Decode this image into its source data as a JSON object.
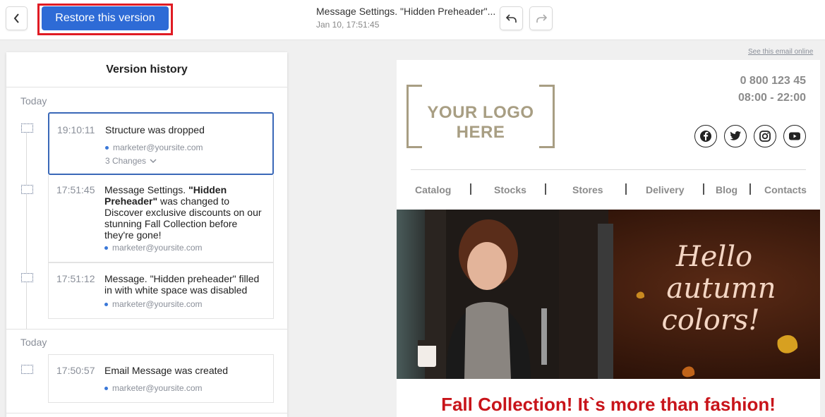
{
  "toolbar": {
    "restore_label": "Restore this version",
    "doc_title": "Message Settings. \"Hidden Preheader\"...",
    "doc_date": "Jan 10, 17:51:45"
  },
  "panel": {
    "title": "Version history",
    "groups": [
      {
        "label": "Today",
        "entries": [
          {
            "time": "19:10:11",
            "text": "Structure was dropped",
            "user": "marketer@yoursite.com",
            "changes": "3 Changes"
          },
          {
            "time": "17:51:45",
            "text_before": "Message Settings. ",
            "text_bold": "\"Hidden Preheader\"",
            "text_after": " was changed to Discover exclusive discounts on our stunning Fall Collection before they're gone!",
            "user": "marketer@yoursite.com"
          },
          {
            "time": "17:51:12",
            "text": "Message. \"Hidden preheader\" filled in with white space was disabled",
            "user": "marketer@yoursite.com"
          }
        ]
      },
      {
        "label": "Today",
        "entries": [
          {
            "time": "17:50:57",
            "text": "Email Message was created",
            "user": "marketer@yoursite.com"
          }
        ]
      }
    ]
  },
  "preview": {
    "see_online": "See this email online",
    "logo_text": "YOUR LOGO HERE",
    "phone": "0 800 123 45",
    "hours": "08:00 - 22:00",
    "social_icons": [
      "facebook-icon",
      "twitter-icon",
      "instagram-icon",
      "youtube-icon"
    ],
    "nav": [
      "Catalog",
      "Stocks",
      "Stores",
      "Delivery",
      "Blog",
      "Contacts"
    ],
    "hero_text_lines": [
      "Hello",
      "autumn",
      "colors!"
    ],
    "promo_title": "Fall Collection! It`s more than fashion!"
  },
  "colors": {
    "accent": "#2e6bd6",
    "highlight_outline": "#e01b24",
    "selected_border": "#3a68b8",
    "logo": "#a89e83",
    "promo": "#c8141a",
    "hero_bg": "#3a1a0e",
    "hero_text": "#f4d6c4"
  }
}
